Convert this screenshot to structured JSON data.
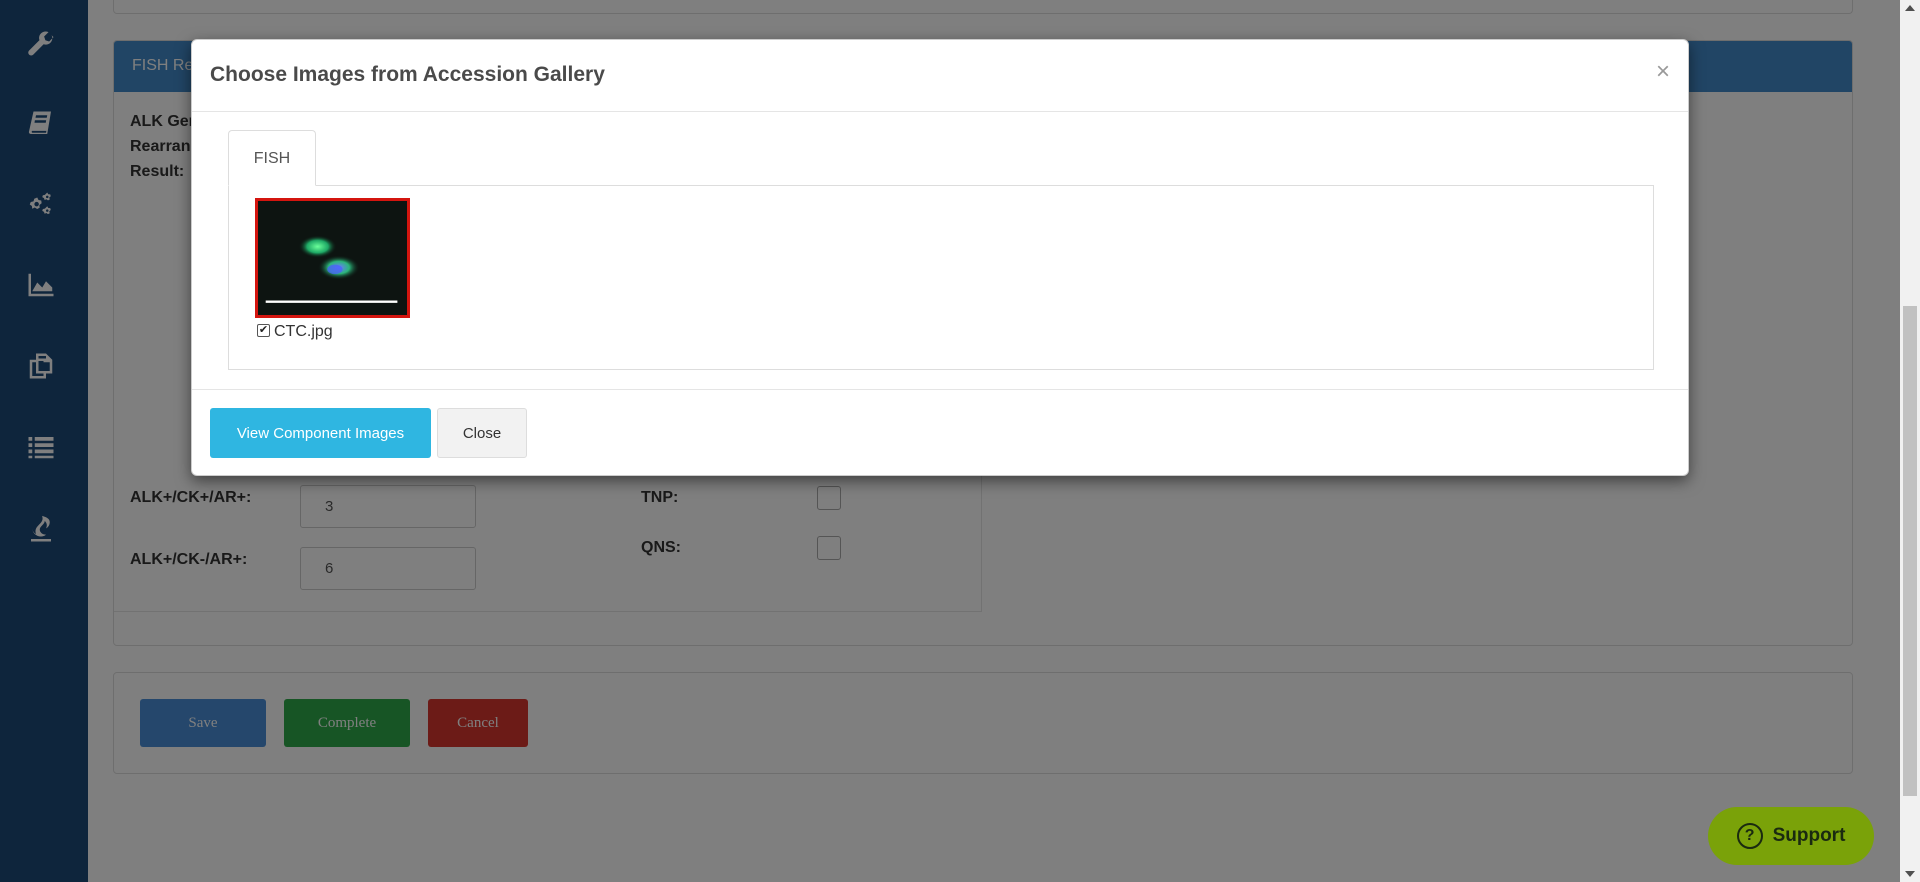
{
  "sidebar": {
    "icons": [
      "wrench-icon",
      "book-icon",
      "gears-icon",
      "area-chart-icon",
      "copy-icon",
      "list-icon",
      "fire-icon"
    ]
  },
  "panel": {
    "heading": "FISH Re",
    "gene_lines": [
      "ALK Gen",
      "Rearran",
      "Result:"
    ],
    "fields": [
      {
        "label": "ALK+/CK+/AR+:",
        "value": "3"
      },
      {
        "label": "ALK+/CK-/AR+:",
        "value": "6"
      }
    ],
    "checks": [
      {
        "label": "TNP:"
      },
      {
        "label": "QNS:"
      }
    ]
  },
  "actions": {
    "save": "Save",
    "complete": "Complete",
    "cancel": "Cancel"
  },
  "modal": {
    "title": "Choose Images from Accession Gallery",
    "close_glyph": "×",
    "tab": "FISH",
    "image": {
      "filename": "CTC.jpg",
      "checked": true
    },
    "buttons": {
      "view": "View Component Images",
      "close": "Close"
    }
  },
  "support": {
    "label": "Support",
    "icon_glyph": "?"
  },
  "colors": {
    "sidebar": "#1c4a78",
    "panel_heading": "#428bca",
    "save": "#4a8fd8",
    "complete": "#2eab4a",
    "cancel": "#d9362f",
    "view_button": "#2fb6e1",
    "support": "#7aa209",
    "thumb_border": "#d4150f"
  }
}
